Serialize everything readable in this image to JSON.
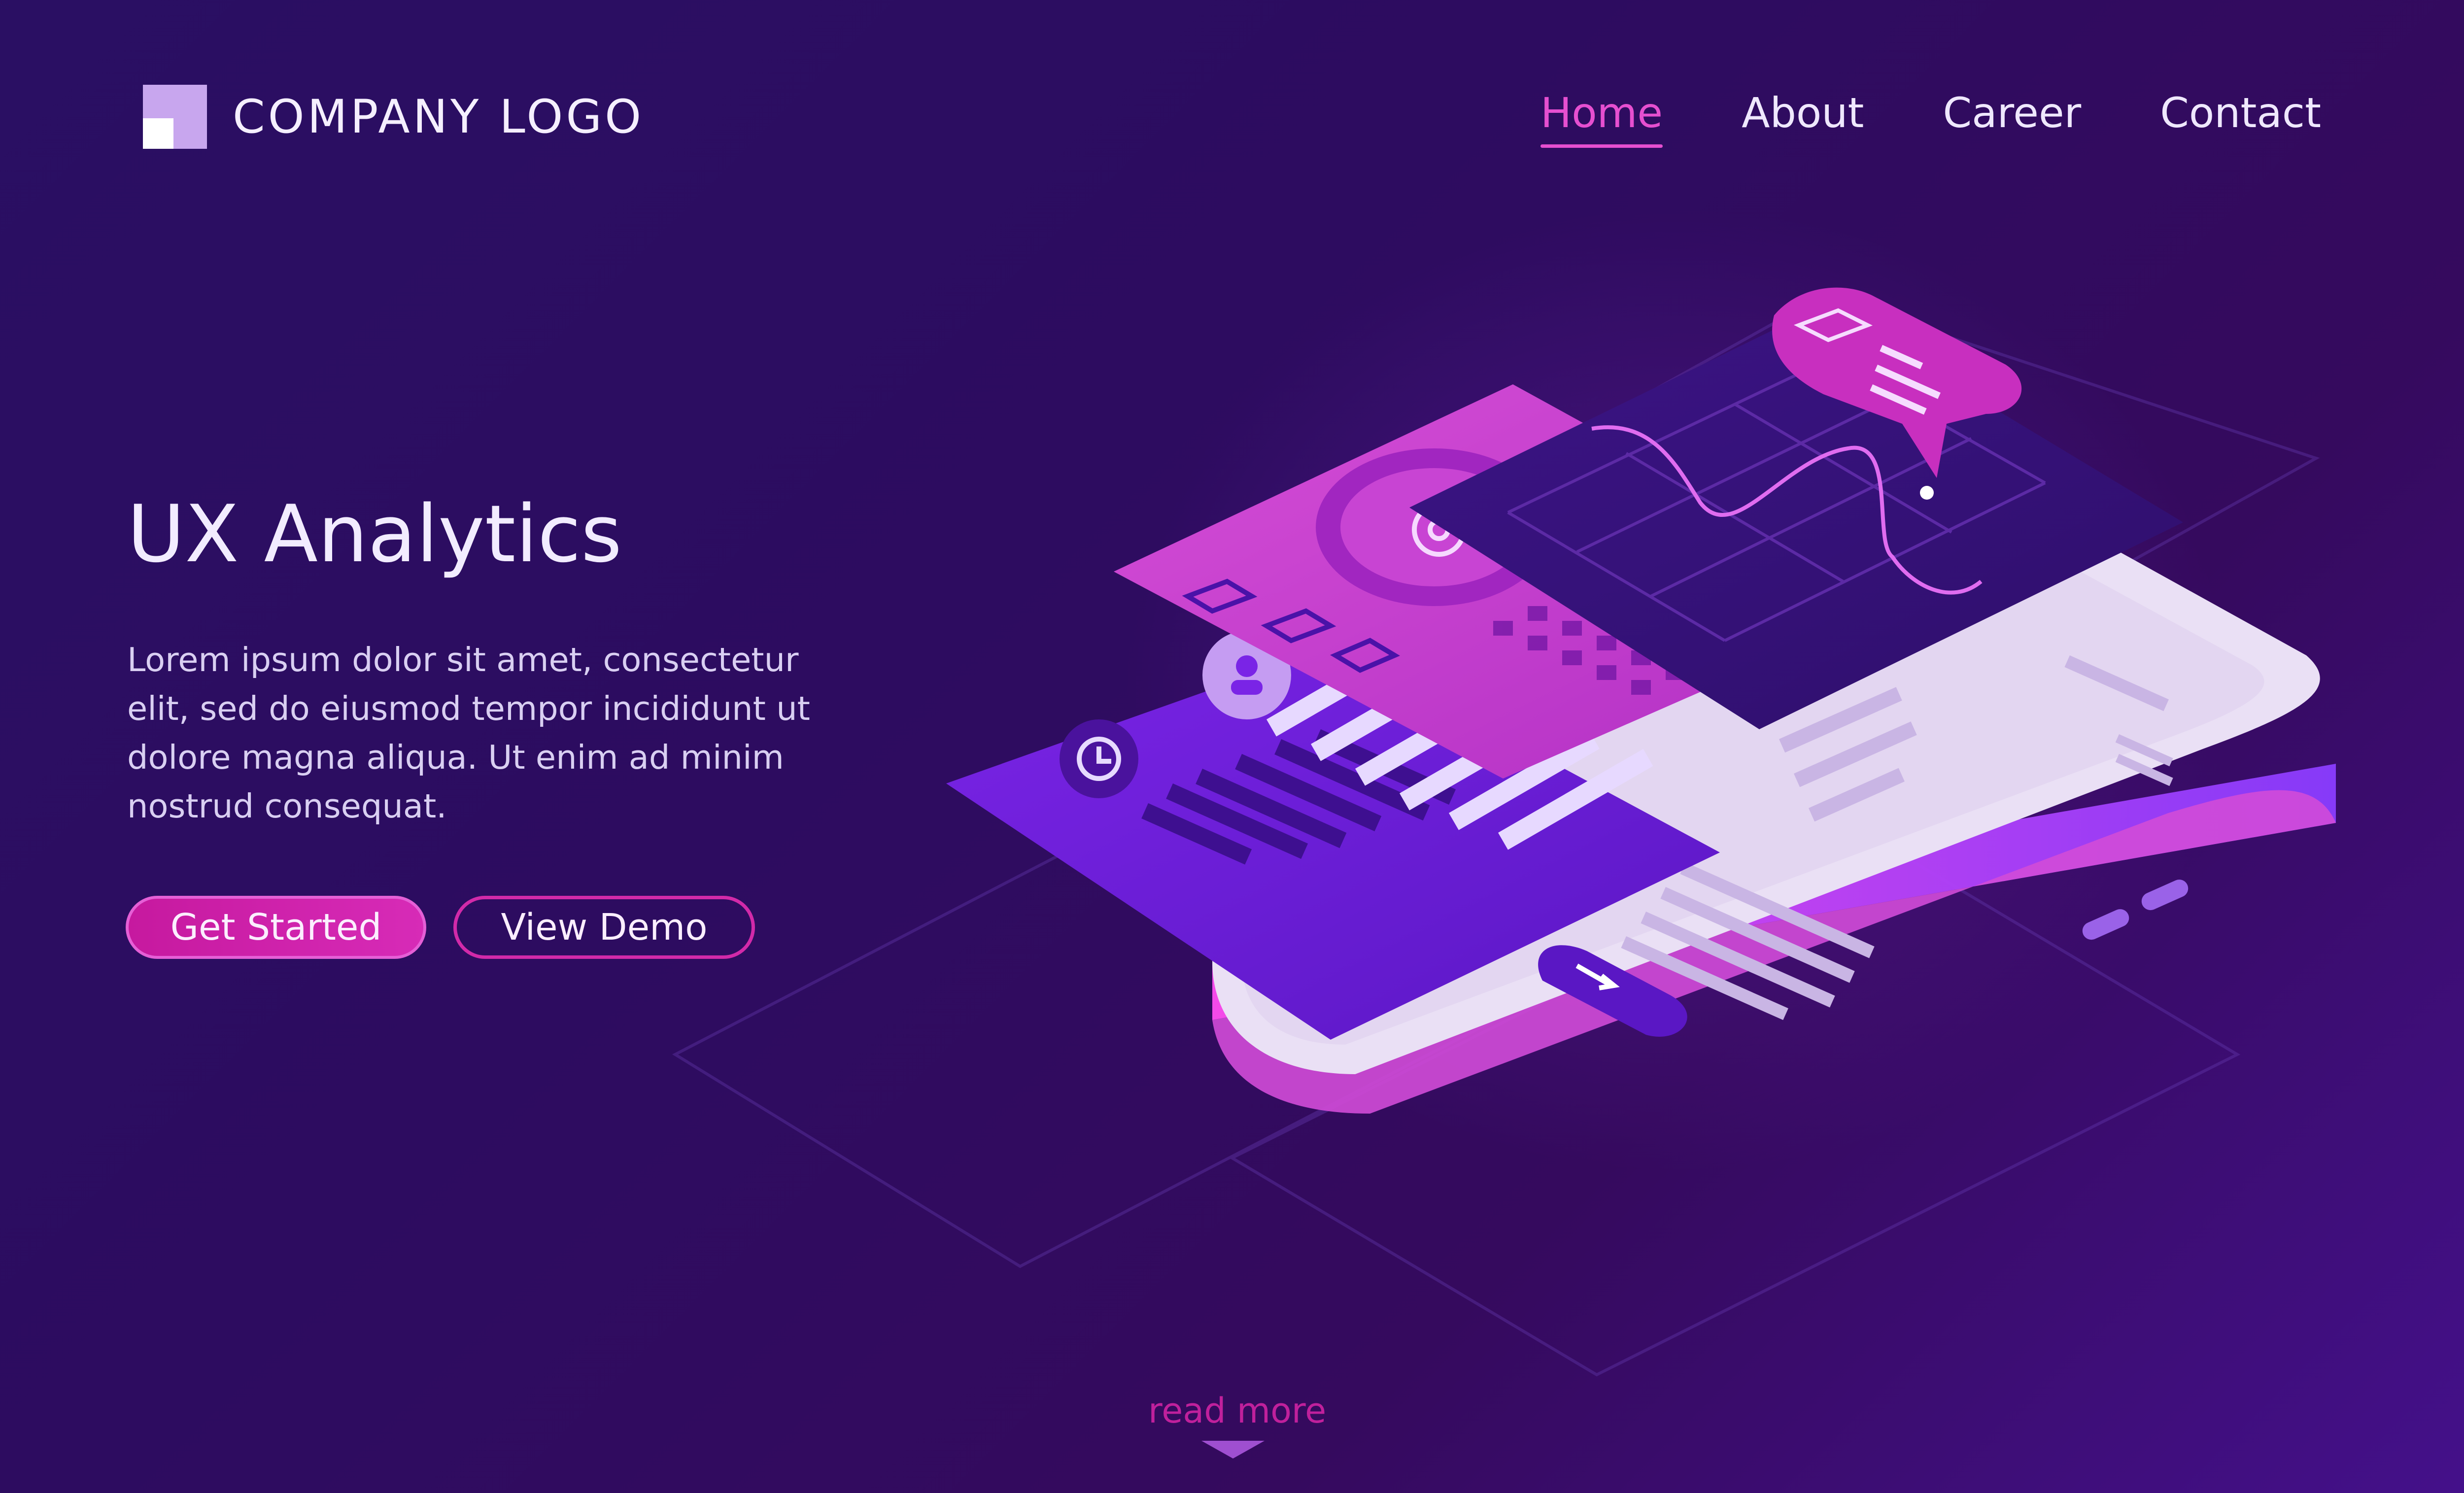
{
  "header": {
    "logo_text": "COMPANY LOGO",
    "nav": [
      {
        "label": "Home",
        "active": true
      },
      {
        "label": "About",
        "active": false
      },
      {
        "label": "Career",
        "active": false
      },
      {
        "label": "Contact",
        "active": false
      }
    ]
  },
  "hero": {
    "title": "UX Analytics",
    "text": "Lorem ipsum dolor sit amet, consectetur elit, sed do eiusmod tempor incididunt ut dolore magna aliqua. Ut enim ad minim nostrud consequat.",
    "primary_button": "Get Started",
    "secondary_button": "View Demo"
  },
  "footer": {
    "read_more": "read more"
  },
  "colors": {
    "accent": "#e64fd0",
    "primary_button": "#c6199f",
    "background": "#2d0c60"
  },
  "icons": [
    "logo-icon",
    "gear-icon",
    "clock-icon",
    "user-icon",
    "bar-chart-icon",
    "down-arrow-icon"
  ]
}
